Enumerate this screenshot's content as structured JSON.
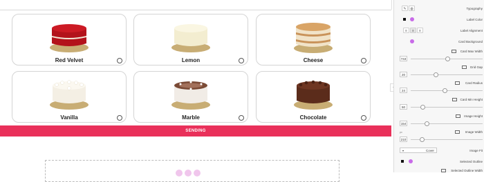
{
  "cards": [
    {
      "name": "Red Velvet",
      "icon": "red-velvet-cake-image"
    },
    {
      "name": "Lemon",
      "icon": "lemon-cake-image"
    },
    {
      "name": "Cheese",
      "icon": "cheese-cake-image"
    },
    {
      "name": "Vanilla",
      "icon": "vanilla-cake-image"
    },
    {
      "name": "Marble",
      "icon": "marble-cake-image"
    },
    {
      "name": "Chocolate",
      "icon": "chocolate-cake-image"
    }
  ],
  "send_label": "SENDING",
  "panel": {
    "typography": "Typography",
    "label_color": "Label Color",
    "label_alignment": "Label Alignment",
    "card_background": "Card Background",
    "card_max_width": {
      "label": "Card Max Width",
      "value": "743"
    },
    "grid_gap": {
      "label": "Grid Gap",
      "value": "20"
    },
    "card_radius": {
      "label": "Card Radius",
      "value": "24"
    },
    "card_min_height": {
      "label": "Card Min Height",
      "value": "50"
    },
    "image_height": {
      "label": "Image Height",
      "value": "154"
    },
    "image_width": {
      "label": "Image Width",
      "value": "210",
      "unit": "px"
    },
    "image_fit": {
      "label": "Image Fit",
      "value": "Cover"
    },
    "selected_outline": "Selected Outline",
    "selected_outline_width": "Selected Outline Width"
  },
  "colors": {
    "accent": "#e9305a",
    "swatch_magenta": "#c86be8",
    "swatch_black": "#111111"
  }
}
